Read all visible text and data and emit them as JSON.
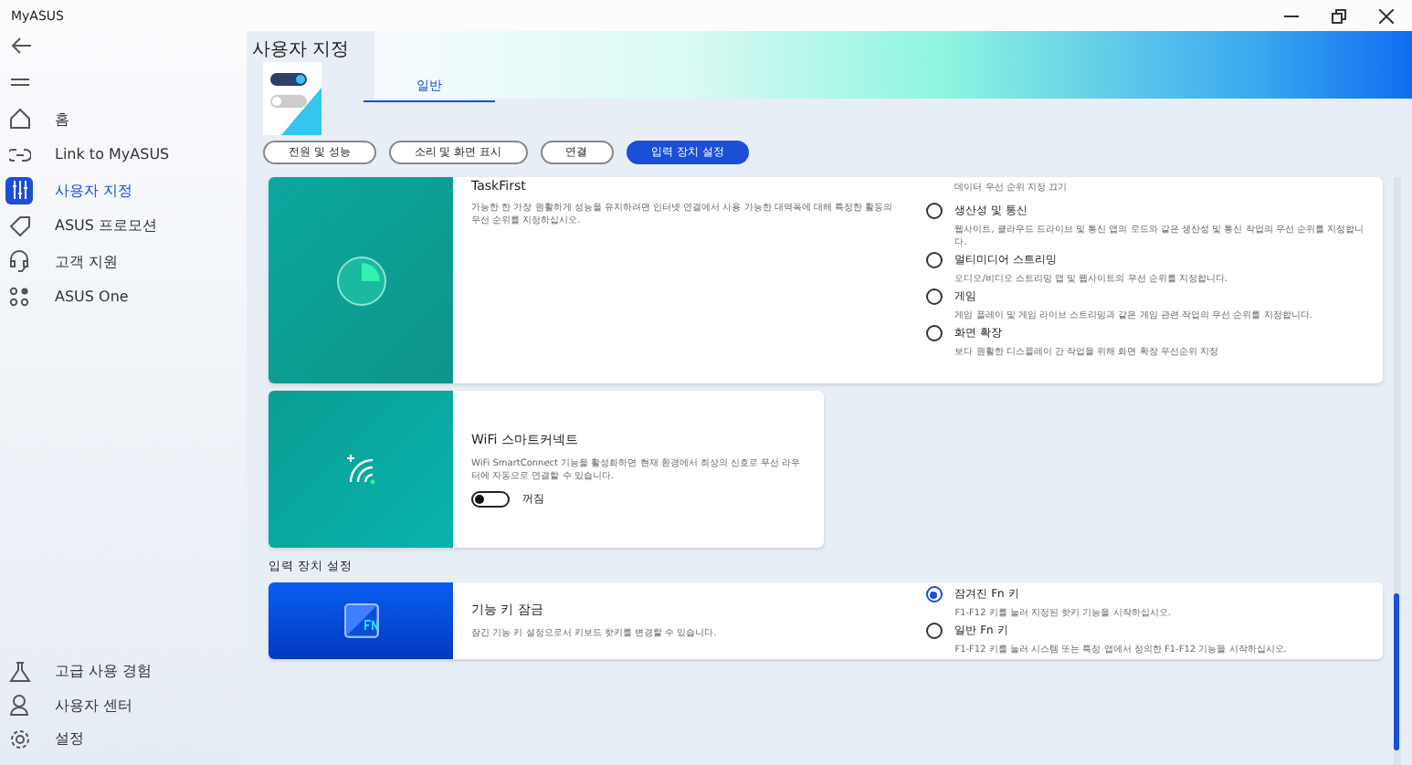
{
  "window": {
    "title": "MyASUS"
  },
  "sidebar": {
    "items": [
      {
        "label": "홈",
        "selected": false
      },
      {
        "label": "Link to MyASUS",
        "selected": false
      },
      {
        "label": "사용자 지정",
        "selected": true
      },
      {
        "label": "ASUS 프로모션",
        "selected": false
      },
      {
        "label": "고객 지원",
        "selected": false
      },
      {
        "label": "ASUS One",
        "selected": false
      }
    ],
    "bottom_items": [
      {
        "label": "고급 사용 경험",
        "selected": false
      },
      {
        "label": "사용자 센터",
        "selected": false
      },
      {
        "label": "설정",
        "selected": false
      }
    ]
  },
  "page_title": "사용자 지정",
  "tabs": [
    {
      "label": "일반",
      "selected": true
    }
  ],
  "categories": [
    {
      "label": "전원 및 성능",
      "selected": false
    },
    {
      "label": "소리 및 화면 표시",
      "selected": false
    },
    {
      "label": "연결",
      "selected": false
    },
    {
      "label": "입력 장치 설정",
      "selected": true
    }
  ],
  "cards": [
    {
      "kind": "options",
      "title": "TaskFirst",
      "description": "가능한 한 가장 원활하게 성능을 유지하려면 인터넷 연결에서 사용 가능한 대역폭에 대해 특정한 활동의 우선 순위를 지정하십시오.",
      "lead_note": "데이터 우선 순위 지정 끄기",
      "options": [
        {
          "label": "생산성 및 통신",
          "description": "웹사이트, 클라우드 드라이브 및 통신 앱의 로드와 같은 생산성 및 통신 작업의 우선 순위를 지정합니다.",
          "selected": false
        },
        {
          "label": "멀티미디어 스트리밍",
          "description": "오디오/비디오 스트리밍 앱 및 웹사이트의 우선 순위를 지정합니다.",
          "selected": false
        },
        {
          "label": "게임",
          "description": "게임 플레이 및 게임 라이브 스트리밍과 같은 게임 관련 작업의 우선 순위를 지정합니다.",
          "selected": false
        },
        {
          "label": "화면 확장",
          "description": "보다 원활한 디스플레이 간 작업을 위해 화면 확장 우선순위 지정",
          "selected": false
        }
      ]
    },
    {
      "kind": "toggle",
      "title": "WiFi 스마트커넥트",
      "description": "WiFi SmartConnect 기능을 활성화하면 현재 환경에서 최상의 신호로 무선 라우터에 자동으로 연결할 수 있습니다.",
      "on": false,
      "state_label": "꺼짐"
    },
    {
      "kind": "options",
      "section": "입력 장치 설정",
      "title": "기능 키 잠금",
      "description": "잠긴 기능 키 설정으로서 키보드 핫키를 변경할 수 있습니다.",
      "options": [
        {
          "label": "잠겨진 Fn 키",
          "description": "F1-F12 키를 눌러 지정된 핫키 기능을 시작하십시오.",
          "selected": true
        },
        {
          "label": "일반 Fn 키",
          "description": "F1-F12 키를 눌러 시스템 또는 특정 앱에서 정의한 F1-F12 기능을 시작하십시오.",
          "selected": false
        }
      ]
    }
  ]
}
